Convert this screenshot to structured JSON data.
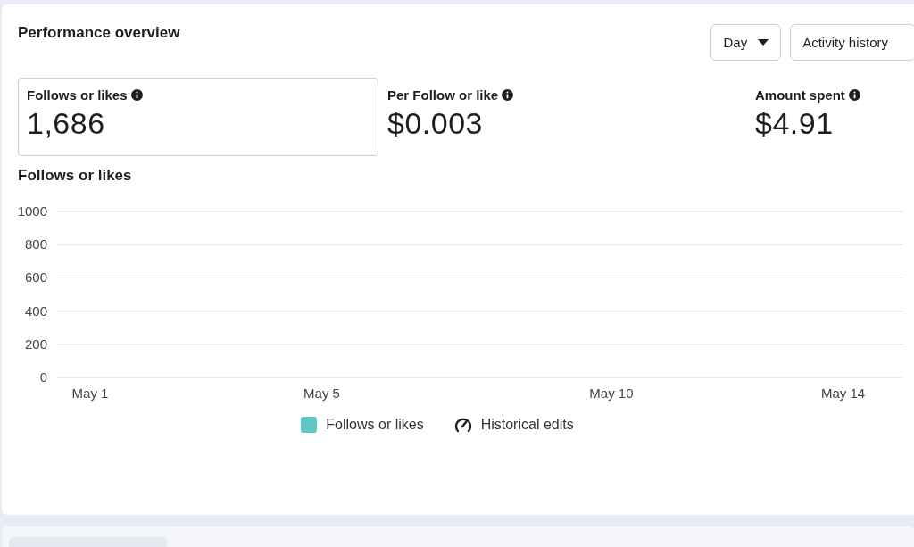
{
  "card": {
    "title": "Performance overview",
    "period_dropdown": {
      "label": "Day"
    },
    "activity_button": {
      "label": "Activity history"
    }
  },
  "metrics": [
    {
      "label": "Follows or likes",
      "value": "1,686",
      "selected": true
    },
    {
      "label": "Per Follow or like",
      "value": "$0.003",
      "selected": false
    },
    {
      "label": "Amount spent",
      "value": "$4.91",
      "selected": false
    }
  ],
  "chart": {
    "title": "Follows or likes",
    "chart_data": {
      "type": "line",
      "grid": true,
      "ylim": [
        0,
        1000
      ],
      "yticks": [
        0,
        200,
        400,
        600,
        800,
        1000
      ],
      "categories": [
        "May 1",
        null,
        null,
        null,
        "May 5",
        null,
        null,
        null,
        null,
        "May 10",
        null,
        null,
        null,
        "May 14",
        null
      ]
    },
    "legend": [
      {
        "kind": "swatch",
        "label": "Follows or likes",
        "color": "#5ec8c6"
      },
      {
        "kind": "icon",
        "label": "Historical edits"
      }
    ]
  }
}
